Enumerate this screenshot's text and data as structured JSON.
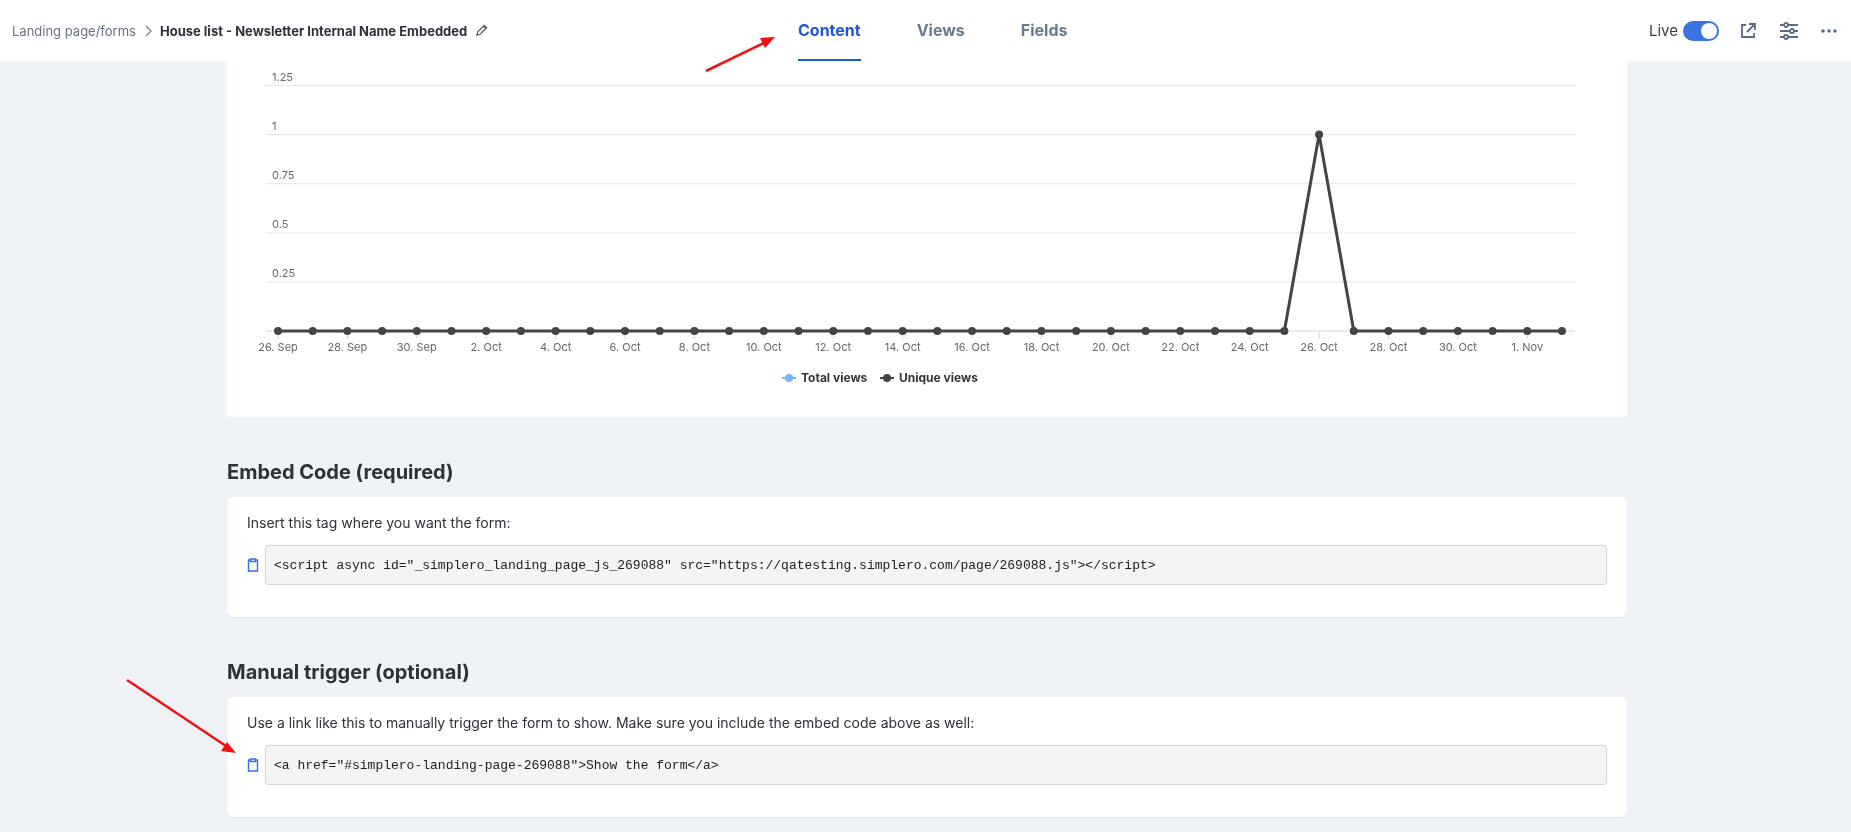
{
  "breadcrumb": {
    "parent": "Landing page/forms",
    "title": "House list - Newsletter Internal Name Embedded"
  },
  "tabs": [
    {
      "label": "Content",
      "selected": true
    },
    {
      "label": "Views",
      "selected": false
    },
    {
      "label": "Fields",
      "selected": false
    }
  ],
  "live": {
    "label": "Live",
    "on": true
  },
  "chart": {
    "chart_data": {
      "type": "line",
      "grid": true,
      "legend": true,
      "categories": [
        "26. Sep",
        null,
        "28. Sep",
        null,
        "30. Sep",
        null,
        "2. Oct",
        null,
        "4. Oct",
        null,
        "6. Oct",
        null,
        "8. Oct",
        null,
        "10. Oct",
        null,
        "12. Oct",
        null,
        "14. Oct",
        null,
        "16. Oct",
        null,
        "18. Oct",
        null,
        "20. Oct",
        null,
        "22. Oct",
        null,
        "24. Oct",
        null,
        "26. Oct",
        null,
        "28. Oct",
        null,
        "30. Oct",
        null,
        "1. Nov",
        null
      ],
      "series": [
        {
          "name": "Total views",
          "color": "#7cb5ec",
          "marker": true,
          "values": [
            null,
            null,
            null,
            null,
            null,
            null,
            null,
            null,
            null,
            null,
            null,
            null,
            null,
            null,
            null,
            null,
            null,
            null,
            null,
            null,
            null,
            null,
            null,
            null,
            null,
            null,
            null,
            null,
            null,
            null,
            null,
            null,
            null,
            null,
            null,
            null,
            null,
            null
          ]
        },
        {
          "name": "Unique views",
          "color": "#434348",
          "marker": true,
          "values": [
            0,
            0,
            0,
            0,
            0,
            0,
            0,
            0,
            0,
            0,
            0,
            0,
            0,
            0,
            0,
            0,
            0,
            0,
            0,
            0,
            0,
            0,
            0,
            0,
            0,
            0,
            0,
            0,
            0,
            0,
            1,
            0,
            0,
            0,
            0,
            0,
            0,
            0
          ]
        }
      ],
      "ylim": [
        0,
        1.25
      ],
      "yticks": [
        0.25,
        0.5,
        0.75,
        1,
        1.25
      ]
    }
  },
  "sections": [
    {
      "heading": "Embed Code (required)",
      "instruction": "Insert this tag where you want the form:",
      "code": "<script async id=\"_simplero_landing_page_js_269088\" src=\"https://qatesting.simplero.com/page/269088.js\"></script>"
    },
    {
      "heading": "Manual trigger (optional)",
      "instruction": "Use a link like this to manually trigger the form to show. Make sure you include the embed code above as well:",
      "code": "<a href=\"#simplero-landing-page-269088\">Show the form</a>"
    }
  ]
}
